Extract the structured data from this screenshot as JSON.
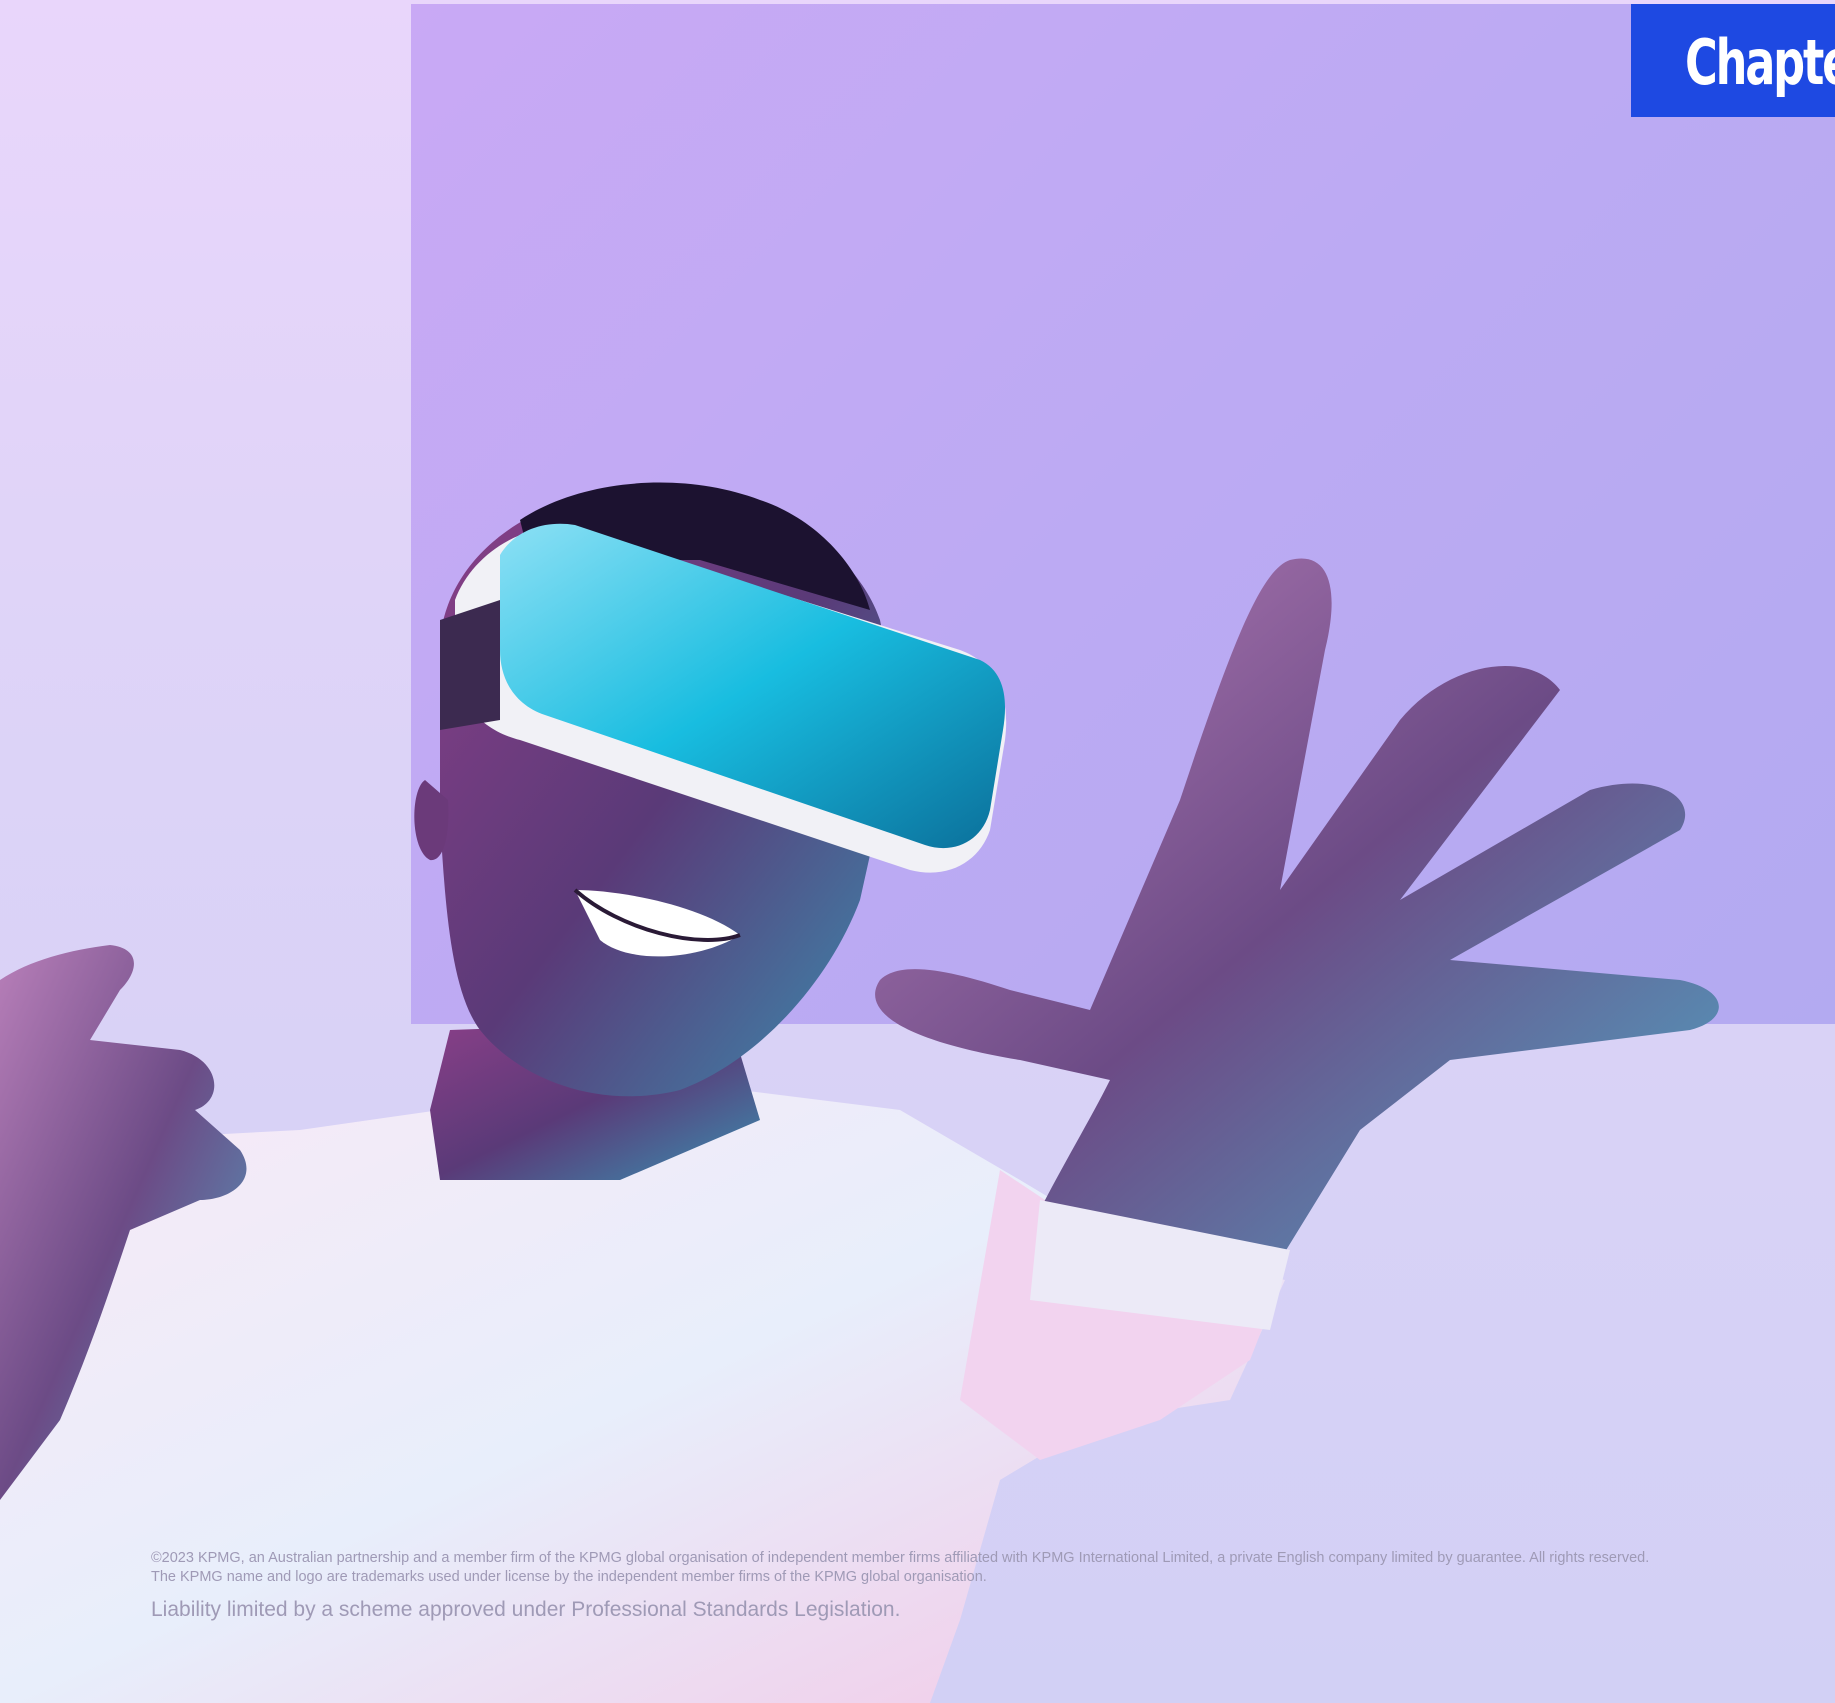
{
  "header": {
    "chapter_label": "Chapte"
  },
  "hero_image": {
    "description_icon": "vr-headset-person-image"
  },
  "footer": {
    "copyright_line_1": "©2023 KPMG, an Australian partnership and a member firm of the KPMG global organisation of independent member firms affiliated with KPMG International Limited, a private English company limited by guarantee. All rights reserved.",
    "copyright_line_2": "The KPMG name and logo are trademarks used under license by the independent member firms of the KPMG global organisation.",
    "liability": "Liability limited by a scheme approved under Professional Standards Legislation."
  },
  "colors": {
    "background_top": "#e9d6fb",
    "panel": "#c9a9f5",
    "chapter_tab": "#1e49e2",
    "legal_text": "#9f9ab6"
  }
}
